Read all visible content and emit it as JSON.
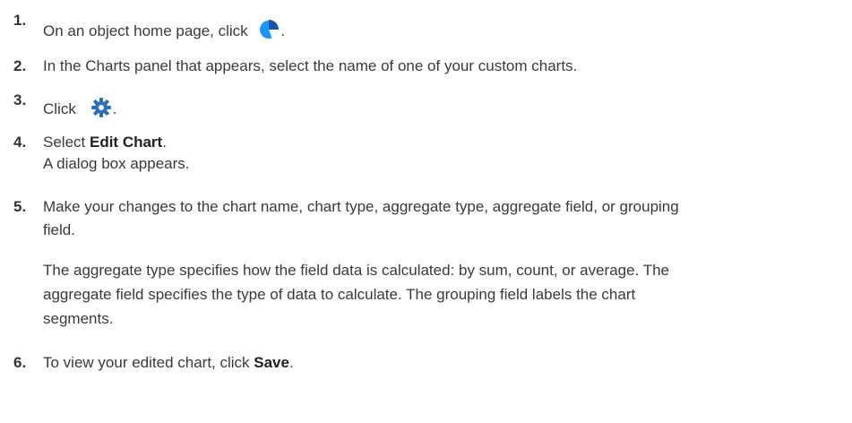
{
  "steps": [
    {
      "number": "1.",
      "pre": "On an object home page, click",
      "post": ".",
      "icon": "pie-chart-icon",
      "icon_color": "#1b96ff"
    },
    {
      "number": "2.",
      "text": "In the Charts panel that appears, select the name of one of your custom charts."
    },
    {
      "number": "3.",
      "pre": "Click",
      "post": ".",
      "icon": "gear-icon",
      "icon_color": "#2e6fb8"
    },
    {
      "number": "4.",
      "pre": "Select ",
      "bold": "Edit Chart",
      "post": ".",
      "note": "A dialog box appears."
    },
    {
      "number": "5.",
      "line1": "Make your changes to the chart name, chart type, aggregate type, aggregate field, or grouping",
      "line2": "field.",
      "para1": "The aggregate type specifies how the field data is calculated: by sum, count, or average. The",
      "para2": "aggregate field specifies the type of data to calculate. The grouping field labels the chart",
      "para3": "segments."
    },
    {
      "number": "6.",
      "pre": "To view your edited chart, click ",
      "bold": "Save",
      "post": "."
    }
  ]
}
